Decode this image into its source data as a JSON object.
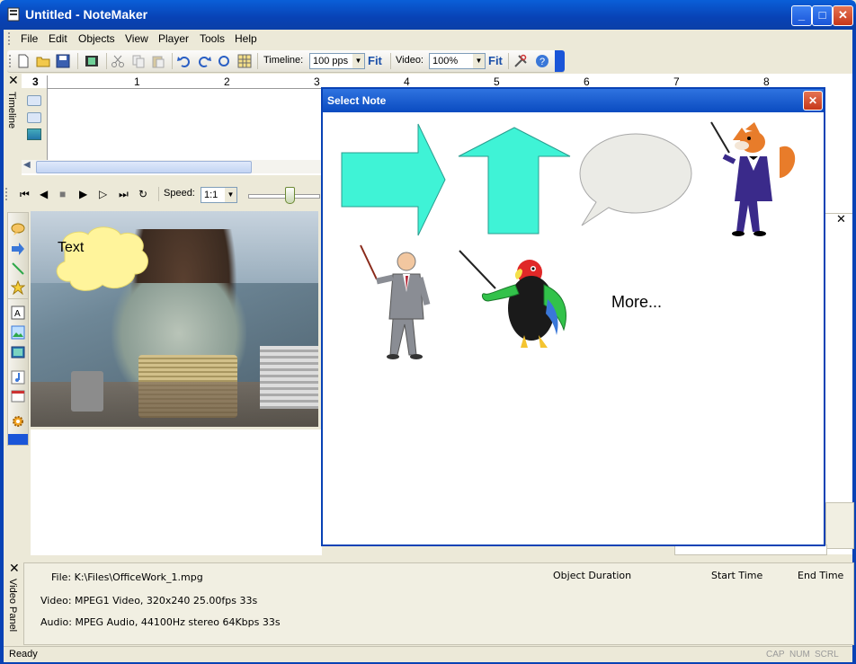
{
  "window": {
    "title": "Untitled - NoteMaker",
    "controls": {
      "minimize": "_",
      "maximize": "□",
      "close": "✕"
    }
  },
  "menu": [
    "File",
    "Edit",
    "Objects",
    "View",
    "Player",
    "Tools",
    "Help"
  ],
  "toolbar": {
    "timeline_label": "Timeline:",
    "timeline_value": "100 pps",
    "fit1": "Fit",
    "video_label": "Video:",
    "video_value": "100%",
    "fit2": "Fit"
  },
  "timeline": {
    "tab_label": "Timeline",
    "current_marker": "3",
    "ticks": [
      "1",
      "2",
      "3",
      "4",
      "5",
      "6",
      "7",
      "8"
    ]
  },
  "player": {
    "speed_label": "Speed:",
    "speed_value": "1:1"
  },
  "video": {
    "callout_text": "Text"
  },
  "dialog": {
    "title": "Select Note",
    "more_label": "More..."
  },
  "bottom_panel": {
    "tab_label": "Video Panel",
    "file": "File: K:\\Files\\OfficeWork_1.mpg",
    "video": "Video: MPEG1 Video, 320x240 25.00fps 33s",
    "audio": "Audio: MPEG Audio, 44100Hz stereo 64Kbps 33s",
    "columns": [
      "Object Duration",
      "Start Time",
      "End Time"
    ]
  },
  "status": {
    "text": "Ready",
    "indicators": [
      "CAP",
      "NUM",
      "SCRL"
    ]
  },
  "colors": {
    "accent": "#0842b5",
    "note_fill": "#3ff3d6",
    "callout": "#fff49b"
  }
}
